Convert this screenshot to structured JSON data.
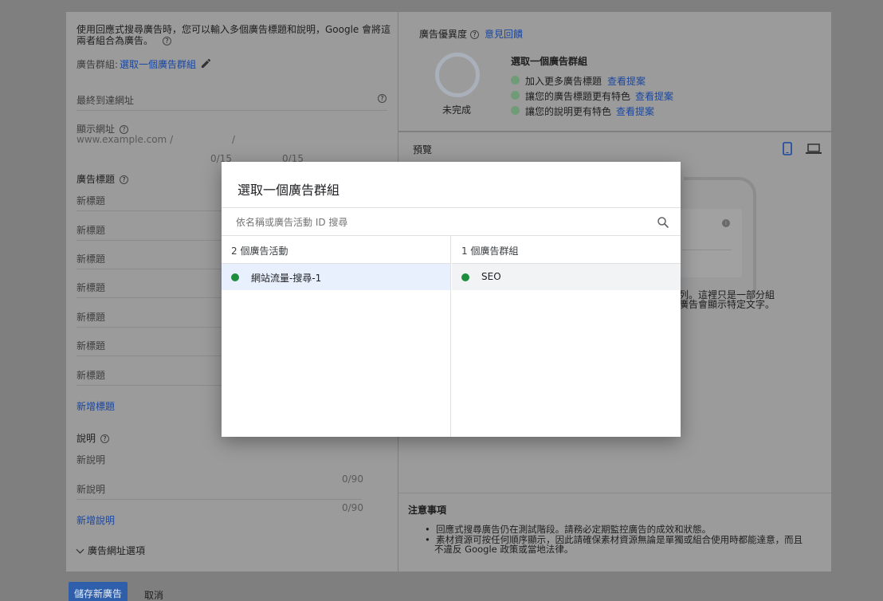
{
  "left": {
    "intro_line1": "使用回應式搜尋廣告時，您可以輸入多個廣告標題和說明，Google 會將這",
    "intro_line2": "兩者組合為廣告。",
    "ad_group_label": "廣告群組:",
    "ad_group_link": "選取一個廣告群組",
    "final_url": "最終到達網址",
    "display_url_label": "顯示網址",
    "display_url_value": "www.example.com /",
    "display_url_sep": "/",
    "path1_count": "0/15",
    "path2_count": "0/15",
    "headlines_label": "廣告標題",
    "headlines": [
      "新標題",
      "新標題",
      "新標題",
      "新標題",
      "新標題",
      "新標題",
      "新標題"
    ],
    "add_headline": "新增標題",
    "descriptions_label": "說明",
    "descriptions": [
      "新說明",
      "新說明"
    ],
    "description_counts": [
      "0/90",
      "0/90"
    ],
    "add_description": "新增說明",
    "url_options": "廣告網址選項"
  },
  "strength": {
    "title": "廣告優異度",
    "feedback": "意見回饋",
    "status": "未完成",
    "heading": "選取一個廣告群組",
    "items": [
      {
        "text": "加入更多廣告標題",
        "link": "查看提案"
      },
      {
        "text": "讓您的廣告標題更有特色",
        "link": "查看提案"
      },
      {
        "text": "讓您的說明更有特色",
        "link": "查看提案"
      }
    ]
  },
  "preview": {
    "title": "預覽",
    "snippet_line1": "列。這裡只是一部分組",
    "snippet_line2": "廣告會顯示特定文字。"
  },
  "notes": {
    "title": "注意事項",
    "bullet1": "回應式搜尋廣告仍在測試階段。請務必定期監控廣告的成效和狀態。",
    "bullet2_line1": "素材資源可按任何順序顯示，因此請確保素材資源無論是單獨或組合使用時都能達意，而且",
    "bullet2_line2": "不違反 Google 政策或當地法律。"
  },
  "footer": {
    "save": "儲存新廣告",
    "cancel": "取消"
  },
  "modal": {
    "title": "選取一個廣告群組",
    "search_placeholder": "依名稱或廣告活動 ID 搜尋",
    "campaigns_header": "2 個廣告活動",
    "adgroups_header": "1 個廣告群組",
    "campaigns": [
      {
        "name": "網站流量-搜尋-1",
        "status_color": "#1e8e3e"
      }
    ],
    "adgroups": [
      {
        "name": "SEO",
        "status_color": "#1e8e3e"
      }
    ]
  }
}
